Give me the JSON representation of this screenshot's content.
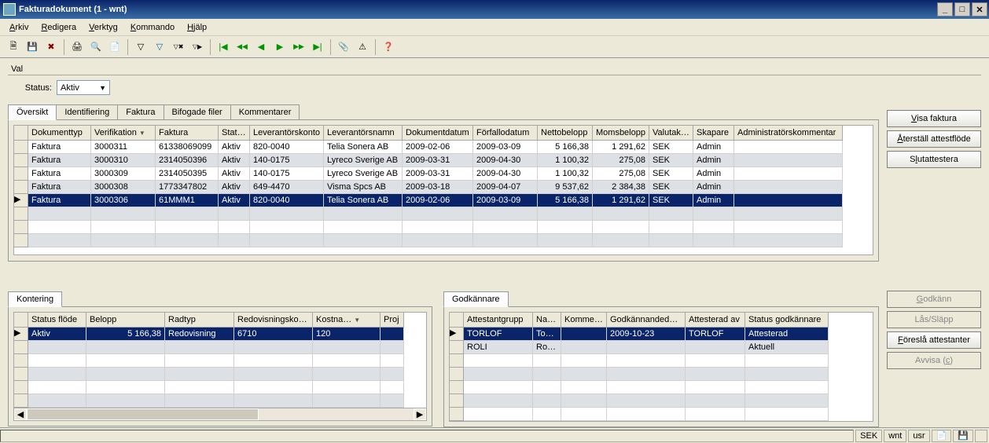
{
  "window": {
    "title": "Fakturadokument (1 - wnt)"
  },
  "menu": {
    "arkiv": "Arkiv",
    "redigera": "Redigera",
    "verktyg": "Verktyg",
    "kommando": "Kommando",
    "hjalp": "Hjälp"
  },
  "section_val": "Val",
  "status_label": "Status:",
  "status_value": "Aktiv",
  "tabs_main": [
    "Översikt",
    "Identifiering",
    "Faktura",
    "Bifogade filer",
    "Kommentarer"
  ],
  "grid_main": {
    "headers": [
      "Dokumenttyp",
      "Verifikation",
      "Faktura",
      "Status",
      "Leverantörskonto",
      "Leverantörsnamn",
      "Dokumentdatum",
      "Förfallodatum",
      "Nettobelopp",
      "Momsbelopp",
      "Valutakod",
      "Skapare",
      "Administratörskommentar"
    ],
    "rows": [
      [
        "Faktura",
        "3000311",
        "61338069099",
        "Aktiv",
        "820-0040",
        "Telia Sonera AB",
        "2009-02-06",
        "2009-03-09",
        "5 166,38",
        "1 291,62",
        "SEK",
        "Admin",
        ""
      ],
      [
        "Faktura",
        "3000310",
        "2314050396",
        "Aktiv",
        "140-0175",
        "Lyreco Sverige AB",
        "2009-03-31",
        "2009-04-30",
        "1 100,32",
        "275,08",
        "SEK",
        "Admin",
        ""
      ],
      [
        "Faktura",
        "3000309",
        "2314050395",
        "Aktiv",
        "140-0175",
        "Lyreco Sverige AB",
        "2009-03-31",
        "2009-04-30",
        "1 100,32",
        "275,08",
        "SEK",
        "Admin",
        ""
      ],
      [
        "Faktura",
        "3000308",
        "1773347802",
        "Aktiv",
        "649-4470",
        "Visma Spcs AB",
        "2009-03-18",
        "2009-04-07",
        "9 537,62",
        "2 384,38",
        "SEK",
        "Admin",
        ""
      ],
      [
        "Faktura",
        "3000306",
        "61MMM1",
        "Aktiv",
        "820-0040",
        "Telia Sonera AB",
        "2009-02-06",
        "2009-03-09",
        "5 166,38",
        "1 291,62",
        "SEK",
        "Admin",
        ""
      ]
    ],
    "selected": 4
  },
  "tab_kontering": "Kontering",
  "grid_kontering": {
    "headers": [
      "Status flöde",
      "Belopp",
      "Radtyp",
      "Redovisningskonto",
      "Kostna…",
      "Proj"
    ],
    "rows": [
      [
        "Aktiv",
        "5 166,38",
        "Redovisning",
        "6710",
        "120",
        ""
      ]
    ],
    "selected": 0
  },
  "tab_godkannare": "Godkännare",
  "grid_godkannare": {
    "headers": [
      "Attestantgrupp",
      "Namn",
      "Kommentar",
      "Godkännandedatum",
      "Attesterad av",
      "Status godkännare"
    ],
    "rows": [
      [
        "TORLOF",
        "To…",
        "",
        "2009-10-23",
        "TORLOF",
        "Attesterad"
      ],
      [
        "ROLI",
        "Ro…",
        "",
        "",
        "",
        "Aktuell"
      ]
    ],
    "selected": 0
  },
  "right_btns": {
    "visa": "Visa faktura",
    "aterstall": "Återställ attestflöde",
    "slutattestera": "Slutattestera"
  },
  "right_btns2": {
    "godkann": "Godkänn",
    "las": "Lås/Släpp",
    "foresla": "Föreslå attestanter",
    "avvisa": "Avvisa (c)"
  },
  "status": {
    "cur": "SEK",
    "env": "wnt",
    "user": "usr"
  }
}
